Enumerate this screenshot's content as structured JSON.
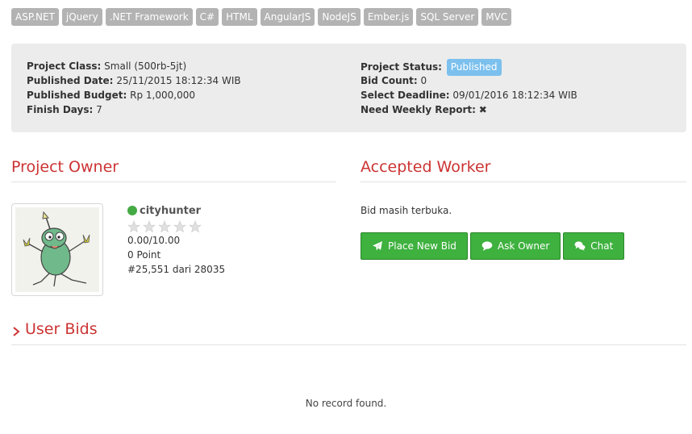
{
  "tags": [
    "ASP.NET",
    "jQuery",
    ".NET Framework",
    "C#",
    "HTML",
    "AngularJS",
    "NodeJS",
    "Ember.js",
    "SQL Server",
    "MVC"
  ],
  "info": {
    "left": [
      {
        "label": "Project Class:",
        "value": "Small (500rb-5jt)"
      },
      {
        "label": "Published Date:",
        "value": "25/11/2015 18:12:34 WIB"
      },
      {
        "label": "Published Budget:",
        "value": "Rp 1,000,000"
      },
      {
        "label": "Finish Days:",
        "value": "7"
      }
    ],
    "right": {
      "status_label": "Project Status:",
      "status_value": "Published",
      "bid_count_label": "Bid Count:",
      "bid_count_value": "0",
      "deadline_label": "Select Deadline:",
      "deadline_value": "09/01/2016 18:12:34 WIB",
      "weekly_label": "Need Weekly Report:",
      "weekly_value": "✖"
    }
  },
  "owner": {
    "section_title": "Project Owner",
    "name": "cityhunter",
    "online": true,
    "rating_stars": 0,
    "rating": "0.00/10.00",
    "points": "0 Point",
    "rank": "#25,551 dari 28035"
  },
  "worker": {
    "section_title": "Accepted Worker",
    "status_text": "Bid masih terbuka.",
    "buttons": {
      "place_bid": "Place New Bid",
      "ask_owner": "Ask Owner",
      "chat": "Chat"
    }
  },
  "bids": {
    "section_title": "User Bids",
    "empty_text": "No record found."
  },
  "colors": {
    "accent_red": "#cc3333",
    "button_green": "#3eb13e",
    "tag_gray": "#b3b3b3",
    "badge_blue": "#7cc0ee",
    "online_green": "#44aa44"
  }
}
